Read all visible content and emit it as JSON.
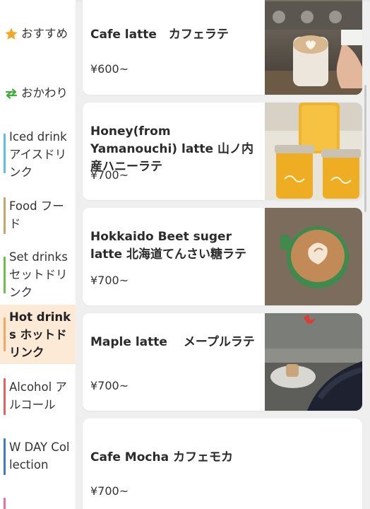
{
  "sidebar": {
    "favorites_label": "おすすめ",
    "refill_label": "おかわり",
    "categories": [
      {
        "label": "Iced drink アイスドリンク",
        "color": "#5cc0e6"
      },
      {
        "label": "Food フード",
        "color": "#c9a36b"
      },
      {
        "label": "Set drinks セットドリンク",
        "color": "#6cc04a"
      },
      {
        "label": "Hot drinks ホットドリンク",
        "color": "#f0a860",
        "active": true
      },
      {
        "label": "Alcohol アルコール",
        "color": "#e86060"
      },
      {
        "label": "W DAY Collection",
        "color": "#3f7cc0"
      },
      {
        "label": "",
        "color": "#ee6ea8"
      }
    ],
    "colors": {
      "star": "#f5a623",
      "refill": "#3fae3a",
      "active_bg": "#fce9d6"
    }
  },
  "menu_items": [
    {
      "title": "Cafe latte　カフェラテ",
      "price": "¥600~"
    },
    {
      "title": "Honey(from Yamanouchi) latte 山ノ内産ハニーラテ",
      "price": "¥700~"
    },
    {
      "title": "Hokkaido Beet suger latte 北海道てんさい糖ラテ",
      "price": "¥700~"
    },
    {
      "title": "Maple latte　 メープルラテ",
      "price": "¥700~"
    },
    {
      "title": "Cafe Mocha カフェモカ",
      "price": "¥700~"
    }
  ]
}
